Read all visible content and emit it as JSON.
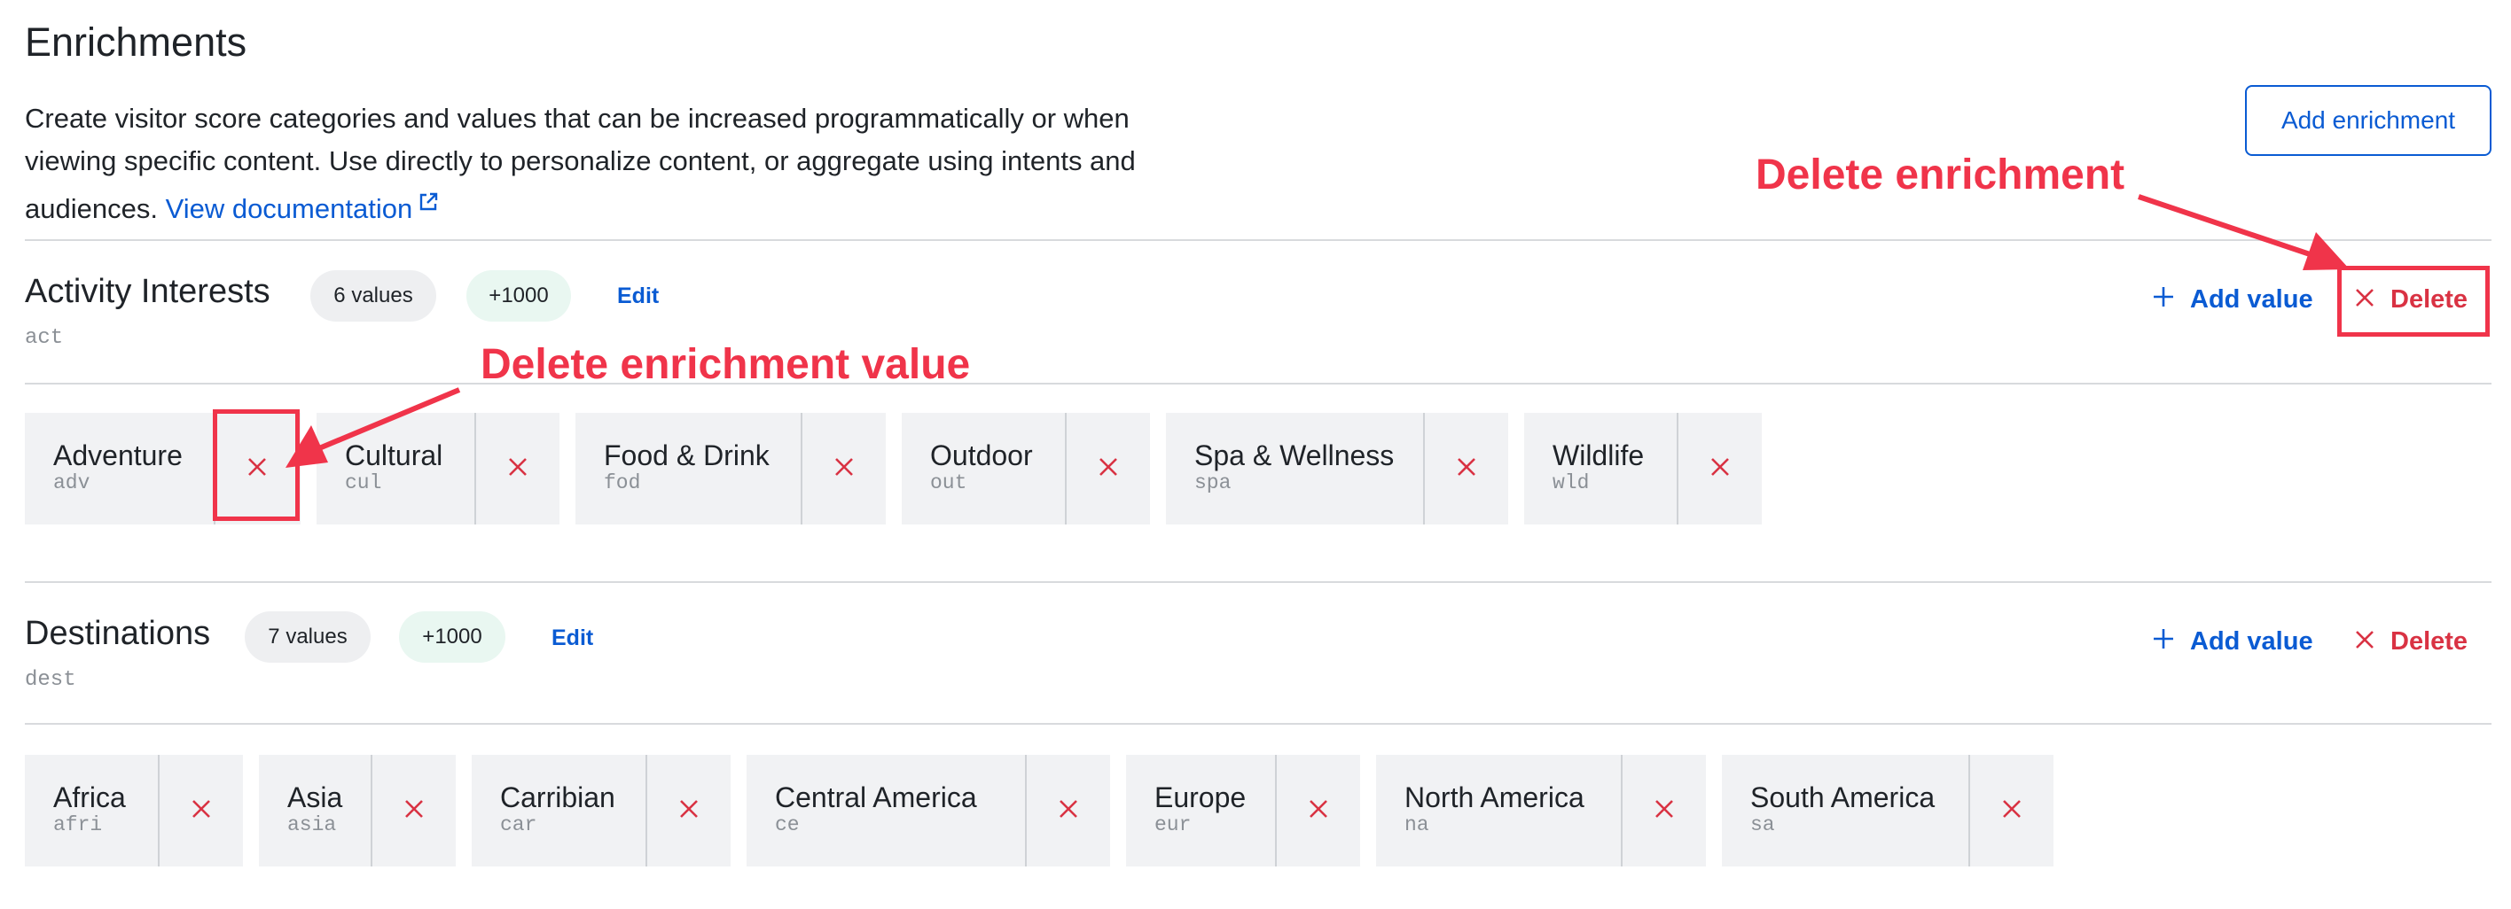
{
  "page": {
    "title": "Enrichments",
    "description": "Create visitor score categories and values that can be increased programmatically or when viewing specific content. Use directly to personalize content, or aggregate using intents and audiences.",
    "doc_link": "View documentation",
    "add_enrichment_label": "Add enrichment"
  },
  "icons": {
    "external_link": "external-link-icon",
    "plus": "plus-icon",
    "close": "close-icon"
  },
  "colors": {
    "accent": "#0a5bd3",
    "danger": "#d93243",
    "annotation": "#f0344a",
    "chip_bg": "#f1f2f4"
  },
  "enrichments": [
    {
      "name": "Activity Interests",
      "key": "act",
      "count_label": "6 values",
      "score_label": "+1000",
      "edit_label": "Edit",
      "add_value_label": "Add value",
      "delete_label": "Delete",
      "values": [
        {
          "label": "Adventure",
          "key": "adv"
        },
        {
          "label": "Cultural",
          "key": "cul"
        },
        {
          "label": "Food & Drink",
          "key": "fod"
        },
        {
          "label": "Outdoor",
          "key": "out"
        },
        {
          "label": "Spa & Wellness",
          "key": "spa"
        },
        {
          "label": "Wildlife",
          "key": "wld"
        }
      ]
    },
    {
      "name": "Destinations",
      "key": "dest",
      "count_label": "7 values",
      "score_label": "+1000",
      "edit_label": "Edit",
      "add_value_label": "Add value",
      "delete_label": "Delete",
      "values": [
        {
          "label": "Africa",
          "key": "afri"
        },
        {
          "label": "Asia",
          "key": "asia"
        },
        {
          "label": "Carribian",
          "key": "car"
        },
        {
          "label": "Central America",
          "key": "ce"
        },
        {
          "label": "Europe",
          "key": "eur"
        },
        {
          "label": "North America",
          "key": "na"
        },
        {
          "label": "South America",
          "key": "sa"
        }
      ]
    }
  ],
  "annotations": {
    "delete_enrichment": "Delete enrichment",
    "delete_enrichment_value": "Delete enrichment value"
  }
}
